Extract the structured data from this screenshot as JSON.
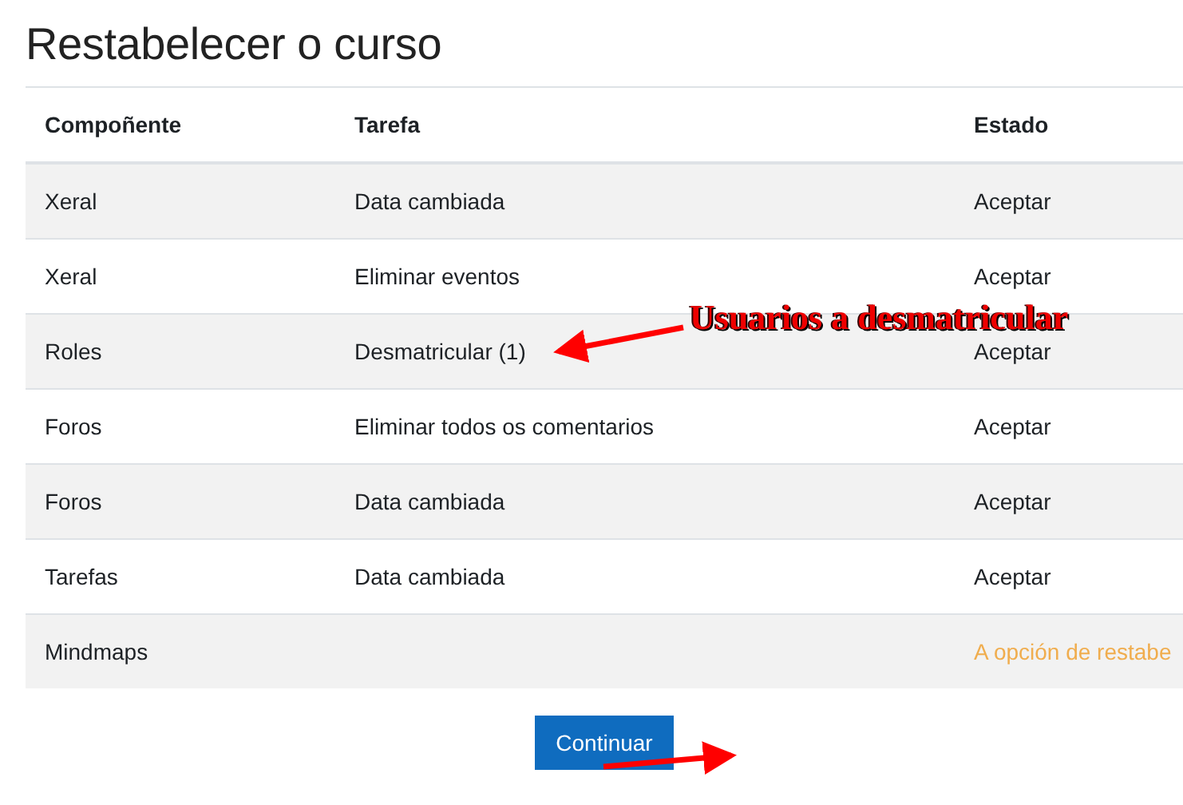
{
  "title": "Restabelecer o curso",
  "table": {
    "columns": [
      "Compoñente",
      "Tarefa",
      "Estado"
    ],
    "rows": [
      {
        "component": "Xeral",
        "task": "Data cambiada",
        "status": "Aceptar",
        "kind": "ok"
      },
      {
        "component": "Xeral",
        "task": "Eliminar eventos",
        "status": "Aceptar",
        "kind": "ok"
      },
      {
        "component": "Roles",
        "task": "Desmatricular (1)",
        "status": "Aceptar",
        "kind": "ok"
      },
      {
        "component": "Foros",
        "task": "Eliminar todos os comentarios",
        "status": "Aceptar",
        "kind": "ok"
      },
      {
        "component": "Foros",
        "task": "Data cambiada",
        "status": "Aceptar",
        "kind": "ok"
      },
      {
        "component": "Tarefas",
        "task": "Data cambiada",
        "status": "Aceptar",
        "kind": "ok"
      },
      {
        "component": "Mindmaps",
        "status": "A opción de restabe",
        "kind": "warning"
      }
    ]
  },
  "button": "Continuar",
  "annotation": "Usuarios a desmatricular"
}
